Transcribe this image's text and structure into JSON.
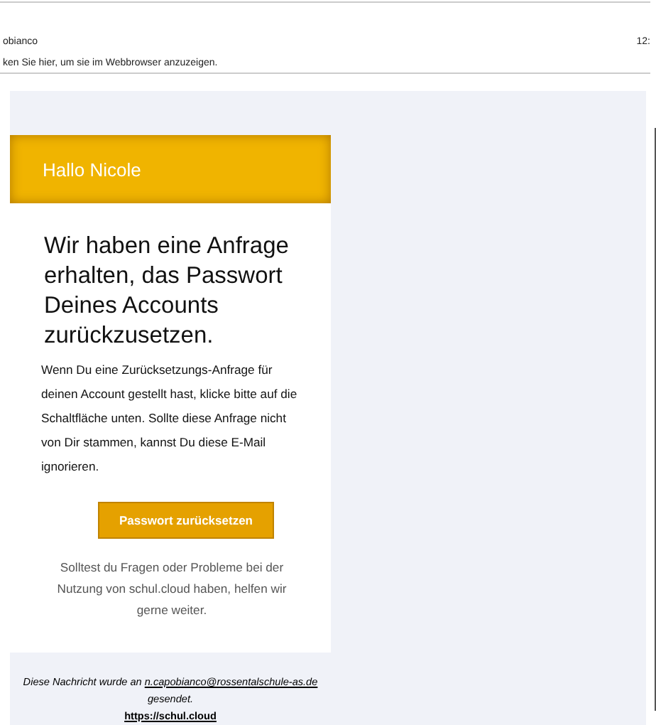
{
  "header": {
    "sender": "obianco",
    "time": "12:"
  },
  "info_bar": {
    "text": "ken Sie hier, um sie im Webbrowser anzuzeigen."
  },
  "email": {
    "greeting": "Hallo Nicole",
    "heading": "Wir haben eine Anfrage erhalten, das Passwort Deines Accounts zurückzusetzen.",
    "body": "Wenn Du eine Zurücksetzungs-Anfrage für deinen Account gestellt hast, klicke bitte auf die Schaltfläche unten. Sollte diese Anfrage nicht von Dir stammen, kannst Du diese E-Mail ignorieren.",
    "button": "Passwort zurücksetzen",
    "help": "Solltest du Fragen oder Probleme bei der Nutzung von schul.cloud haben, helfen wir gerne weiter.",
    "footer_before": "Diese Nachricht wurde an",
    "footer_email": "n.capobianco@rossentalschule-as.de",
    "footer_after": "gesendet.",
    "footer_link": "https://schul.cloud"
  }
}
